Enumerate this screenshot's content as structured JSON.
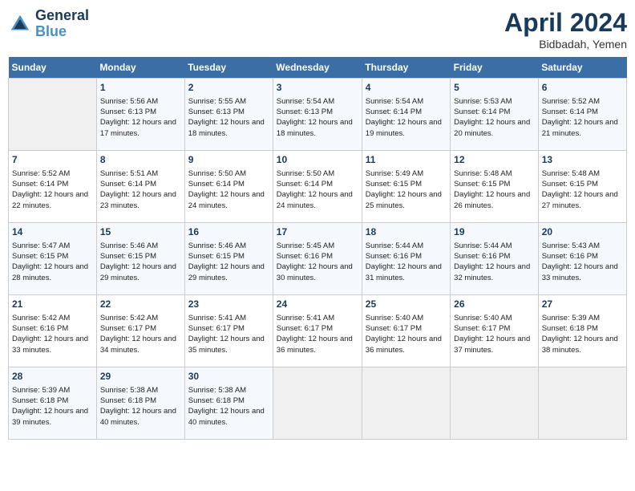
{
  "header": {
    "logo_line1": "General",
    "logo_line2": "Blue",
    "month_year": "April 2024",
    "location": "Bidbadah, Yemen"
  },
  "weekdays": [
    "Sunday",
    "Monday",
    "Tuesday",
    "Wednesday",
    "Thursday",
    "Friday",
    "Saturday"
  ],
  "weeks": [
    [
      {
        "day": "",
        "empty": true
      },
      {
        "day": "1",
        "sunrise": "Sunrise: 5:56 AM",
        "sunset": "Sunset: 6:13 PM",
        "daylight": "Daylight: 12 hours and 17 minutes."
      },
      {
        "day": "2",
        "sunrise": "Sunrise: 5:55 AM",
        "sunset": "Sunset: 6:13 PM",
        "daylight": "Daylight: 12 hours and 18 minutes."
      },
      {
        "day": "3",
        "sunrise": "Sunrise: 5:54 AM",
        "sunset": "Sunset: 6:13 PM",
        "daylight": "Daylight: 12 hours and 18 minutes."
      },
      {
        "day": "4",
        "sunrise": "Sunrise: 5:54 AM",
        "sunset": "Sunset: 6:14 PM",
        "daylight": "Daylight: 12 hours and 19 minutes."
      },
      {
        "day": "5",
        "sunrise": "Sunrise: 5:53 AM",
        "sunset": "Sunset: 6:14 PM",
        "daylight": "Daylight: 12 hours and 20 minutes."
      },
      {
        "day": "6",
        "sunrise": "Sunrise: 5:52 AM",
        "sunset": "Sunset: 6:14 PM",
        "daylight": "Daylight: 12 hours and 21 minutes."
      }
    ],
    [
      {
        "day": "7",
        "sunrise": "Sunrise: 5:52 AM",
        "sunset": "Sunset: 6:14 PM",
        "daylight": "Daylight: 12 hours and 22 minutes."
      },
      {
        "day": "8",
        "sunrise": "Sunrise: 5:51 AM",
        "sunset": "Sunset: 6:14 PM",
        "daylight": "Daylight: 12 hours and 23 minutes."
      },
      {
        "day": "9",
        "sunrise": "Sunrise: 5:50 AM",
        "sunset": "Sunset: 6:14 PM",
        "daylight": "Daylight: 12 hours and 24 minutes."
      },
      {
        "day": "10",
        "sunrise": "Sunrise: 5:50 AM",
        "sunset": "Sunset: 6:14 PM",
        "daylight": "Daylight: 12 hours and 24 minutes."
      },
      {
        "day": "11",
        "sunrise": "Sunrise: 5:49 AM",
        "sunset": "Sunset: 6:15 PM",
        "daylight": "Daylight: 12 hours and 25 minutes."
      },
      {
        "day": "12",
        "sunrise": "Sunrise: 5:48 AM",
        "sunset": "Sunset: 6:15 PM",
        "daylight": "Daylight: 12 hours and 26 minutes."
      },
      {
        "day": "13",
        "sunrise": "Sunrise: 5:48 AM",
        "sunset": "Sunset: 6:15 PM",
        "daylight": "Daylight: 12 hours and 27 minutes."
      }
    ],
    [
      {
        "day": "14",
        "sunrise": "Sunrise: 5:47 AM",
        "sunset": "Sunset: 6:15 PM",
        "daylight": "Daylight: 12 hours and 28 minutes."
      },
      {
        "day": "15",
        "sunrise": "Sunrise: 5:46 AM",
        "sunset": "Sunset: 6:15 PM",
        "daylight": "Daylight: 12 hours and 29 minutes."
      },
      {
        "day": "16",
        "sunrise": "Sunrise: 5:46 AM",
        "sunset": "Sunset: 6:15 PM",
        "daylight": "Daylight: 12 hours and 29 minutes."
      },
      {
        "day": "17",
        "sunrise": "Sunrise: 5:45 AM",
        "sunset": "Sunset: 6:16 PM",
        "daylight": "Daylight: 12 hours and 30 minutes."
      },
      {
        "day": "18",
        "sunrise": "Sunrise: 5:44 AM",
        "sunset": "Sunset: 6:16 PM",
        "daylight": "Daylight: 12 hours and 31 minutes."
      },
      {
        "day": "19",
        "sunrise": "Sunrise: 5:44 AM",
        "sunset": "Sunset: 6:16 PM",
        "daylight": "Daylight: 12 hours and 32 minutes."
      },
      {
        "day": "20",
        "sunrise": "Sunrise: 5:43 AM",
        "sunset": "Sunset: 6:16 PM",
        "daylight": "Daylight: 12 hours and 33 minutes."
      }
    ],
    [
      {
        "day": "21",
        "sunrise": "Sunrise: 5:42 AM",
        "sunset": "Sunset: 6:16 PM",
        "daylight": "Daylight: 12 hours and 33 minutes."
      },
      {
        "day": "22",
        "sunrise": "Sunrise: 5:42 AM",
        "sunset": "Sunset: 6:17 PM",
        "daylight": "Daylight: 12 hours and 34 minutes."
      },
      {
        "day": "23",
        "sunrise": "Sunrise: 5:41 AM",
        "sunset": "Sunset: 6:17 PM",
        "daylight": "Daylight: 12 hours and 35 minutes."
      },
      {
        "day": "24",
        "sunrise": "Sunrise: 5:41 AM",
        "sunset": "Sunset: 6:17 PM",
        "daylight": "Daylight: 12 hours and 36 minutes."
      },
      {
        "day": "25",
        "sunrise": "Sunrise: 5:40 AM",
        "sunset": "Sunset: 6:17 PM",
        "daylight": "Daylight: 12 hours and 36 minutes."
      },
      {
        "day": "26",
        "sunrise": "Sunrise: 5:40 AM",
        "sunset": "Sunset: 6:17 PM",
        "daylight": "Daylight: 12 hours and 37 minutes."
      },
      {
        "day": "27",
        "sunrise": "Sunrise: 5:39 AM",
        "sunset": "Sunset: 6:18 PM",
        "daylight": "Daylight: 12 hours and 38 minutes."
      }
    ],
    [
      {
        "day": "28",
        "sunrise": "Sunrise: 5:39 AM",
        "sunset": "Sunset: 6:18 PM",
        "daylight": "Daylight: 12 hours and 39 minutes."
      },
      {
        "day": "29",
        "sunrise": "Sunrise: 5:38 AM",
        "sunset": "Sunset: 6:18 PM",
        "daylight": "Daylight: 12 hours and 40 minutes."
      },
      {
        "day": "30",
        "sunrise": "Sunrise: 5:38 AM",
        "sunset": "Sunset: 6:18 PM",
        "daylight": "Daylight: 12 hours and 40 minutes."
      },
      {
        "day": "",
        "empty": true
      },
      {
        "day": "",
        "empty": true
      },
      {
        "day": "",
        "empty": true
      },
      {
        "day": "",
        "empty": true
      }
    ]
  ]
}
